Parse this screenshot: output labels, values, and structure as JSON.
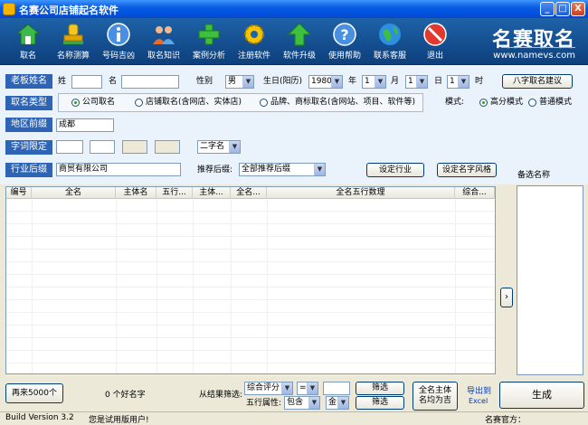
{
  "window": {
    "title": "名赛公司店铺起名软件",
    "minimize": "_",
    "maximize": "□",
    "close": "X"
  },
  "toolbar": {
    "items": [
      {
        "label": "取名",
        "icon": "house-icon"
      },
      {
        "label": "名称测算",
        "icon": "stamp-icon"
      },
      {
        "label": "号码吉凶",
        "icon": "info-icon"
      },
      {
        "label": "取名知识",
        "icon": "people-icon"
      },
      {
        "label": "案例分析",
        "icon": "plus-icon"
      },
      {
        "label": "注册软件",
        "icon": "gear-icon"
      },
      {
        "label": "软件升级",
        "icon": "up-arrow-icon"
      },
      {
        "label": "使用帮助",
        "icon": "help-icon"
      },
      {
        "label": "联系客服",
        "icon": "globe-icon"
      },
      {
        "label": "退出",
        "icon": "exit-icon"
      }
    ],
    "brand": "名赛取名",
    "brand_url": "www.namevs.com"
  },
  "form": {
    "labels": {
      "owner": "老板姓名",
      "naming_type": "取名类型",
      "region": "地区前缀",
      "char_limit": "字词限定",
      "industry": "行业后缀"
    },
    "owner": {
      "surname_label": "姓",
      "surname_value": "",
      "name_label": "名",
      "name_value": "",
      "gender_label": "性别",
      "gender_value": "男",
      "birth_label": "生日(阳历)",
      "year_value": "1980",
      "year_label": "年",
      "month_value": "1",
      "month_label": "月",
      "day_value": "1",
      "day_label": "日",
      "hour_value": "1",
      "hour_label": "时",
      "bazi_button": "八字取名建议"
    },
    "naming_type": {
      "options": [
        "公司取名",
        "店铺取名(含网店、实体店)",
        "品牌、商标取名(含网站、项目、软件等)"
      ],
      "selected_index": 0,
      "mode_label": "模式:",
      "modes": [
        "高分模式",
        "普通模式"
      ],
      "mode_selected_index": 0
    },
    "region_value": "成都",
    "char_limit": {
      "count_value": "二字名"
    },
    "industry": {
      "value": "商贸有限公司",
      "recommend_label": "推荐后缀:",
      "recommend_value": "全部推荐后缀",
      "set_industry_button": "设定行业",
      "set_style_button": "设定名字风格"
    }
  },
  "table": {
    "columns": [
      "编号",
      "全名",
      "主体名",
      "五行...",
      "主体...",
      "全名...",
      "全名五行数理",
      "综合..."
    ],
    "rows": []
  },
  "candidates": {
    "label": "备选名称"
  },
  "bottom": {
    "more_button": "再来5000个",
    "count_text": "0 个好名字",
    "filter_label": "从结果筛选:",
    "filter_field": "综合评分",
    "filter_op": "=",
    "filter_value": "",
    "filter_button": "筛选",
    "wuxing_label": "五行属性:",
    "wuxing_op": "包含",
    "wuxing_value": "金",
    "wuxing_button": "筛选",
    "all_good_button": "全名主体名均为吉",
    "export_label_1": "导出到",
    "export_label_2": "Excel",
    "generate_button": "生成"
  },
  "statusbar": {
    "version": "Build Version 3.2",
    "trial": "您是试用版用户!",
    "footer_right": "名赛官方：www.namevs.com"
  }
}
